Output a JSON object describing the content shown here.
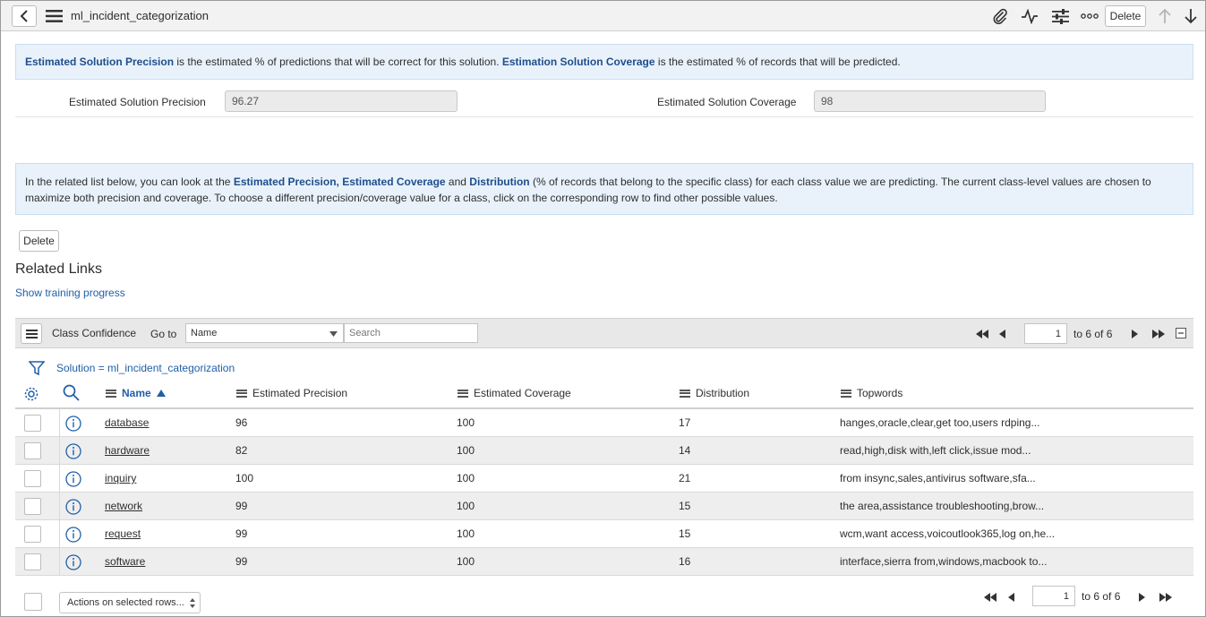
{
  "header": {
    "title": "ml_incident_categorization",
    "delete_label": "Delete"
  },
  "info_top": {
    "term1": "Estimated Solution Precision",
    "text1": " is the estimated % of predictions that will be correct for this solution. ",
    "term2": "Estimation Solution Coverage",
    "text2": " is the estimated % of records that will be predicted."
  },
  "fields": {
    "precision_label": "Estimated Solution Precision",
    "precision_value": "96.27",
    "coverage_label": "Estimated Solution Coverage",
    "coverage_value": "98"
  },
  "info_mid": {
    "text1": "In the related list below, you can look at the ",
    "term1": "Estimated Precision, Estimated Coverage",
    "text2": " and ",
    "term2": "Distribution",
    "text3": " (% of records that belong to the specific class) for each class value we are predicting. The current class-level values are chosen to maximize both precision and coverage. To choose a different precision/coverage value for a class, click on the corresponding row to find other possible values."
  },
  "form": {
    "delete_label": "Delete",
    "related_links_title": "Related Links",
    "show_training_progress": "Show training progress"
  },
  "list": {
    "title": "Class Confidence",
    "goto_label": "Go to",
    "goto_selected": "Name",
    "search_placeholder": "Search",
    "page_value": "1",
    "page_range": "to 6 of 6",
    "filter_text": "Solution = ml_incident_categorization",
    "columns": {
      "name": "Name",
      "precision": "Estimated Precision",
      "coverage": "Estimated Coverage",
      "distribution": "Distribution",
      "topwords": "Topwords"
    },
    "rows": [
      {
        "name": "database",
        "precision": "96",
        "coverage": "100",
        "distribution": "17",
        "topwords": "hanges,oracle,clear,get too,users rdping..."
      },
      {
        "name": "hardware",
        "precision": "82",
        "coverage": "100",
        "distribution": "14",
        "topwords": "read,high,disk with,left click,issue mod..."
      },
      {
        "name": "inquiry",
        "precision": "100",
        "coverage": "100",
        "distribution": "21",
        "topwords": "from insync,sales,antivirus software,sfa..."
      },
      {
        "name": "network",
        "precision": "99",
        "coverage": "100",
        "distribution": "15",
        "topwords": "the area,assistance troubleshooting,brow..."
      },
      {
        "name": "request",
        "precision": "99",
        "coverage": "100",
        "distribution": "15",
        "topwords": "wcm,want access,voicoutlook365,log on,he..."
      },
      {
        "name": "software",
        "precision": "99",
        "coverage": "100",
        "distribution": "16",
        "topwords": "interface,sierra from,windows,macbook to..."
      }
    ],
    "actions_label": "Actions on selected rows...",
    "footer_page_value": "1",
    "footer_page_range": "to 6 of 6"
  },
  "colors": {
    "accent": "#1f5fa8",
    "info_bg": "#e9f2fb",
    "header_bg": "#f2f2f2"
  }
}
